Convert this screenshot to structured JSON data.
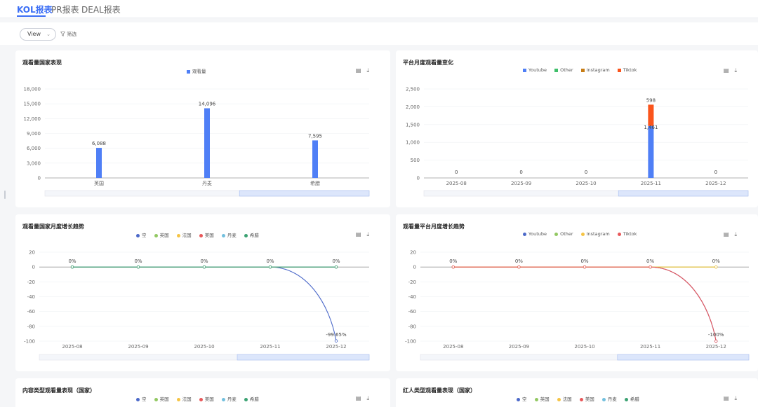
{
  "tabs": [
    {
      "label": "KOL报表",
      "active": true
    },
    {
      "label": "PR报表",
      "active": false
    },
    {
      "label": "DEAL报表",
      "active": false
    }
  ],
  "toolbar": {
    "view_label": "View",
    "filter_label": "筛选"
  },
  "icons": {
    "export": "document-icon",
    "download": "download-icon",
    "filter": "filter-icon",
    "chevron": "chevron-down-icon"
  },
  "colors": {
    "accent": "#3b6ef5",
    "blue": "#4f7ff6",
    "green": "#3fbf6a",
    "orange_brown": "#c77d16",
    "red_orange": "#fa541c",
    "line_blue": "#4c69c9",
    "line_green": "#5aab61",
    "line_red": "#e8585a"
  },
  "panels": [
    {
      "id": "p1",
      "title": "观看量国家表现",
      "chart_data": {
        "type": "bar",
        "categories": [
          "英国",
          "丹麦",
          "希腊"
        ],
        "series": [
          {
            "name": "观看量",
            "values": [
              6088,
              14096,
              7595
            ],
            "color": "#4f7ff6"
          }
        ],
        "value_labels": [
          "6,088",
          "14,096",
          "7,595"
        ],
        "yticks": [
          "0",
          "3,000",
          "6,000",
          "9,000",
          "12,000",
          "15,000",
          "18,000"
        ],
        "ylim": [
          0,
          18000
        ]
      }
    },
    {
      "id": "p2",
      "title": "平台月度观看量变化",
      "chart_data": {
        "type": "bar",
        "stacked": true,
        "categories": [
          "2025-08",
          "2025-09",
          "2025-10",
          "2025-11",
          "2025-12"
        ],
        "series": [
          {
            "name": "Youtube",
            "values": [
              0,
              0,
              0,
              1461,
              0
            ],
            "color": "#4f7ff6"
          },
          {
            "name": "Other",
            "values": [
              0,
              0,
              0,
              0,
              0
            ],
            "color": "#3fbf6a"
          },
          {
            "name": "Instagram",
            "values": [
              0,
              0,
              0,
              0,
              0
            ],
            "color": "#c77d16"
          },
          {
            "name": "Tiktok",
            "values": [
              0,
              0,
              0,
              598,
              0
            ],
            "color": "#fa541c"
          }
        ],
        "value_labels": [
          {
            "category": "2025-08",
            "text": "0"
          },
          {
            "category": "2025-09",
            "text": "0"
          },
          {
            "category": "2025-10",
            "text": "0"
          },
          {
            "category": "2025-11",
            "text": "1,461"
          },
          {
            "category": "2025-11",
            "text": "598"
          },
          {
            "category": "2025-12",
            "text": "0"
          }
        ],
        "yticks": [
          "0",
          "500",
          "1,000",
          "1,500",
          "2,000",
          "2,500"
        ],
        "ylim": [
          0,
          2500
        ]
      }
    },
    {
      "id": "p3",
      "title": "观看量国家月度增长趋势",
      "chart_data": {
        "type": "line",
        "categories": [
          "2025-08",
          "2025-09",
          "2025-10",
          "2025-11",
          "2025-12"
        ],
        "series": [
          {
            "name": "空",
            "values": [
              0,
              0,
              0,
              0,
              -99.65
            ],
            "color": "#4c69c9"
          },
          {
            "name": "英国",
            "values": [
              0,
              0,
              0,
              0,
              0
            ],
            "color": "#92c862"
          },
          {
            "name": "法国",
            "values": [
              0,
              0,
              0,
              0,
              0
            ],
            "color": "#f5c445"
          },
          {
            "name": "美国",
            "values": [
              0,
              0,
              0,
              0,
              0
            ],
            "color": "#e8585a"
          },
          {
            "name": "丹麦",
            "values": [
              0,
              0,
              0,
              0,
              0
            ],
            "color": "#73c0de"
          },
          {
            "name": "希腊",
            "values": [
              0,
              0,
              0,
              0,
              0
            ],
            "color": "#3ba272"
          }
        ],
        "value_labels": [
          "0%",
          "0%",
          "0%",
          "0%",
          "0%",
          "-99.65%"
        ],
        "yticks": [
          "20",
          "0",
          "-20",
          "-40",
          "-60",
          "-80",
          "-100"
        ],
        "ylim": [
          -100,
          20
        ]
      }
    },
    {
      "id": "p4",
      "title": "观看量平台月度增长趋势",
      "chart_data": {
        "type": "line",
        "categories": [
          "2025-08",
          "2025-09",
          "2025-10",
          "2025-11",
          "2025-12"
        ],
        "series": [
          {
            "name": "Youtube",
            "values": [
              0,
              0,
              0,
              0,
              -100
            ],
            "color": "#4c69c9"
          },
          {
            "name": "Other",
            "values": [
              0,
              0,
              0,
              0,
              0
            ],
            "color": "#92c862"
          },
          {
            "name": "Instagram",
            "values": [
              0,
              0,
              0,
              0,
              0
            ],
            "color": "#f5c445"
          },
          {
            "name": "Tiktok",
            "values": [
              0,
              0,
              0,
              0,
              -100
            ],
            "color": "#e8585a"
          }
        ],
        "value_labels": [
          "0%",
          "0%",
          "0%",
          "0%",
          "0%",
          "-100%"
        ],
        "yticks": [
          "20",
          "0",
          "-20",
          "-40",
          "-60",
          "-80",
          "-100"
        ],
        "ylim": [
          -100,
          20
        ]
      }
    },
    {
      "id": "p5",
      "title": "内容类型观看量表现（国家）",
      "legend": [
        "空",
        "英国",
        "法国",
        "美国",
        "丹麦",
        "希腊"
      ],
      "legend_colors": [
        "#4c69c9",
        "#92c862",
        "#f5c445",
        "#e8585a",
        "#73c0de",
        "#3ba272"
      ]
    },
    {
      "id": "p6",
      "title": "红人类型观看量表现（国家）",
      "legend": [
        "空",
        "英国",
        "法国",
        "美国",
        "丹麦",
        "希腊"
      ],
      "legend_colors": [
        "#4c69c9",
        "#92c862",
        "#f5c445",
        "#e8585a",
        "#73c0de",
        "#3ba272"
      ]
    }
  ]
}
